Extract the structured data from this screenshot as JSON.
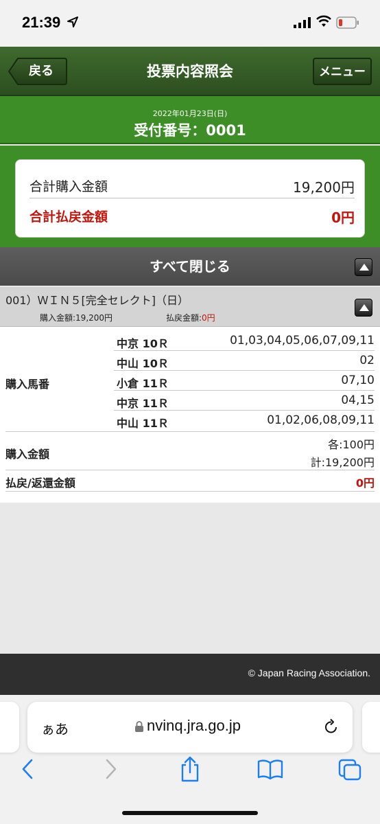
{
  "status_bar": {
    "time": "21:39"
  },
  "header": {
    "back_label": "戻る",
    "title": "投票内容照会",
    "menu_label": "メニュー"
  },
  "receipt": {
    "date": "2022年01月23日(日)",
    "number": "受付番号：0001"
  },
  "totals": {
    "purchase_label": "合計購入金額",
    "purchase_value": "19,200円",
    "refund_label": "合計払戻金額",
    "refund_value": "0円"
  },
  "collapse_all_label": "すべて閉じる",
  "ticket": {
    "title": "001）ＷＩＮ５[完全セレクト]（日）",
    "purchase_summary_label": "購入金額:",
    "purchase_summary_value": "19,200円",
    "refund_summary_label": "払戻金額:",
    "refund_summary_value": "0円",
    "horses_label": "購入馬番",
    "races": [
      {
        "venue": "中京 10Ｒ",
        "horses": "01,03,04,05,06,07,09,11"
      },
      {
        "venue": "中山 10Ｒ",
        "horses": "02"
      },
      {
        "venue": "小倉 11Ｒ",
        "horses": "07,10"
      },
      {
        "venue": "中京 11Ｒ",
        "horses": "04,15"
      },
      {
        "venue": "中山 11Ｒ",
        "horses": "01,02,06,08,09,11"
      }
    ],
    "amount_label": "購入金額",
    "amount_each": "各:100円",
    "amount_total": "計:19,200円",
    "refund_label": "払戻/返還金額",
    "refund_value": "0円"
  },
  "footer": {
    "copyright": "© Japan Racing Association."
  },
  "browser": {
    "aa_label": "ぁあ",
    "url": "nvinq.jra.go.jp"
  },
  "colors": {
    "header_green": "#2f5522",
    "band_green": "#3d8e26",
    "accent_red": "#c0160e",
    "bar_gray": "#545454"
  }
}
